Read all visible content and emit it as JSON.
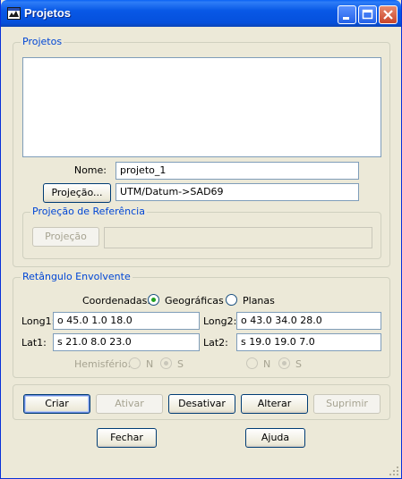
{
  "window": {
    "title": "Projetos"
  },
  "projects_group": {
    "title": "Projetos",
    "name_label": "Nome:",
    "name_value": "projeto_1",
    "projection_button": "Projeção...",
    "projection_value": "UTM/Datum->SAD69"
  },
  "reference_group": {
    "title": "Projeção de Referência",
    "projection_button": "Projeção",
    "projection_value": ""
  },
  "bbox_group": {
    "title": "Retângulo Envolvente",
    "coordinates_label": "Coordenadas:",
    "coord_geographic": "Geográficas",
    "coord_plane": "Planas",
    "coord_selected": "Geográficas",
    "long1_label": "Long1:",
    "long1_value": "o 45.0 1.0 18.0",
    "long2_label": "Long2:",
    "long2_value": "o 43.0 34.0 28.0",
    "lat1_label": "Lat1:",
    "lat1_value": "s 21.0 8.0 23.0",
    "lat2_label": "Lat2:",
    "lat2_value": "s 19.0 19.0 7.0",
    "hemisphere_label": "Hemisfério:",
    "hem_n": "N",
    "hem_s": "S"
  },
  "actions": {
    "create": "Criar",
    "activate": "Ativar",
    "deactivate": "Desativar",
    "change": "Alterar",
    "delete": "Suprimir",
    "close": "Fechar",
    "help": "Ajuda"
  },
  "colors": {
    "titlebar": "#0858e6",
    "group_label": "#0046d5",
    "background": "#ece9d8"
  }
}
